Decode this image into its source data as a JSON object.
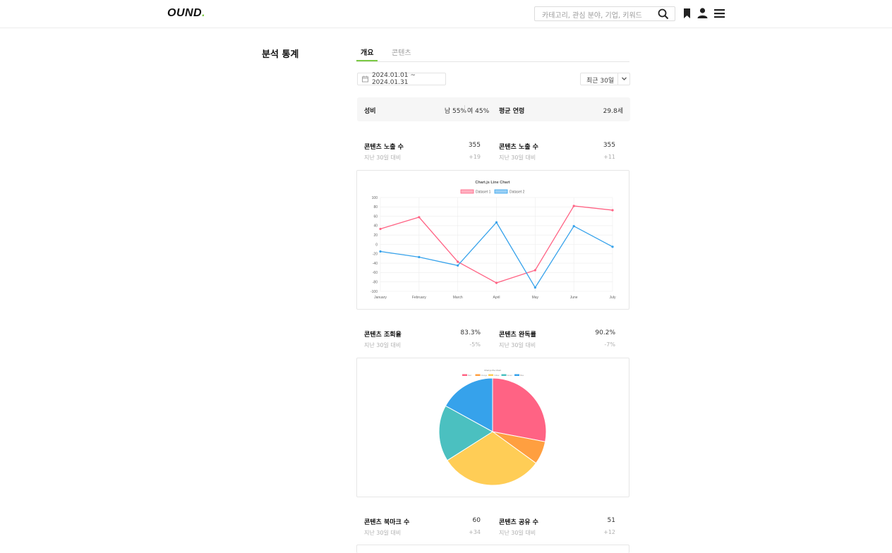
{
  "header": {
    "logo": "OUND",
    "logo_dot": ".",
    "search_placeholder": "카테고리, 관심 분야, 기업, 키워드"
  },
  "page": {
    "title": "분석 통계",
    "tabs": [
      {
        "label": "개요",
        "active": true
      },
      {
        "label": "콘텐츠",
        "active": false
      }
    ]
  },
  "filters": {
    "date_range": "2024.01.01 ~ 2024.01.31",
    "period": "최근 30일"
  },
  "summary": {
    "gender_label": "성비",
    "male": "남 55%",
    "female": "여 45%",
    "age_label": "평균 연령",
    "age_value": "29.8세"
  },
  "stats_row1": [
    {
      "label": "콘텐츠 노출 수",
      "value": "355",
      "sub": "지난 30일 대비",
      "delta": "+19"
    },
    {
      "label": "콘텐츠 노출 수",
      "value": "355",
      "sub": "지난 30일 대비",
      "delta": "+11"
    }
  ],
  "stats_row2": [
    {
      "label": "콘텐츠 조회율",
      "value": "83.3%",
      "sub": "지난 30일 대비",
      "delta": "-5%"
    },
    {
      "label": "콘텐츠 완독률",
      "value": "90.2%",
      "sub": "지난 30일 대비",
      "delta": "-7%"
    }
  ],
  "stats_row3": [
    {
      "label": "콘텐츠 북마크 수",
      "value": "60",
      "sub": "지난 30일 대비",
      "delta": "+34"
    },
    {
      "label": "콘텐츠 공유 수",
      "value": "51",
      "sub": "지난 30일 대비",
      "delta": "+12"
    }
  ],
  "colors": {
    "accent": "#7ac943",
    "dataset1": "#ff6384",
    "dataset2": "#36a2eb"
  },
  "chart_data": [
    {
      "type": "line",
      "title": "Chart.js Line Chart",
      "categories": [
        "January",
        "February",
        "March",
        "April",
        "May",
        "June",
        "July"
      ],
      "series": [
        {
          "name": "Dataset 1",
          "color": "#ff6384",
          "values": [
            33,
            58,
            -37,
            -82,
            -55,
            82,
            73
          ]
        },
        {
          "name": "Dataset 2",
          "color": "#36a2eb",
          "values": [
            -15,
            -27,
            -45,
            47,
            -92,
            39,
            -5
          ]
        }
      ],
      "yticks": [
        "100",
        "80",
        "60",
        "40",
        "20",
        "0",
        "-20",
        "-40",
        "-60",
        "-80",
        "-100"
      ],
      "ylim": [
        -100,
        100
      ],
      "legend": "top",
      "grid": true
    },
    {
      "type": "pie",
      "title": "Chart.js Pie Chart",
      "legend": "top",
      "slices": [
        {
          "label": "Red",
          "value": 28,
          "color": "#ff6384"
        },
        {
          "label": "Orange",
          "value": 7,
          "color": "#ff9f40"
        },
        {
          "label": "Yellow",
          "value": 31,
          "color": "#ffcd56"
        },
        {
          "label": "Green",
          "value": 17,
          "color": "#4bc0c0"
        },
        {
          "label": "Blue",
          "value": 17,
          "color": "#36a2eb"
        }
      ]
    }
  ]
}
